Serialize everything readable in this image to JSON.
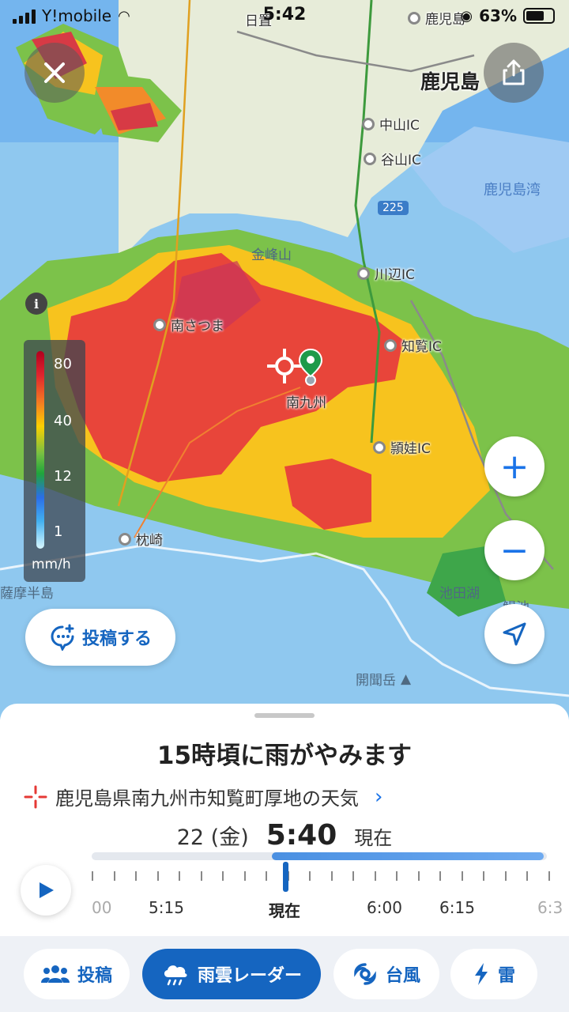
{
  "status_bar": {
    "carrier": "Y!mobile",
    "time": "5:42",
    "battery": "63%"
  },
  "map": {
    "places": {
      "hioki": "日置",
      "kagoshima_top": "鹿児島",
      "kagoshima_city": "鹿児島",
      "nakayama_ic": "中山IC",
      "taniyama_ic": "谷山IC",
      "kagoshima_bay": "鹿児島湾",
      "route_225": "225",
      "kinposan": "金峰山",
      "kawanabe_ic": "川辺IC",
      "minamisatsuma": "南さつま",
      "chiran_ic": "知覧IC",
      "minamikyushu": "南九州",
      "eino_ic": "頴娃IC",
      "makurazaki": "枕崎",
      "satsuma_hanto": "薩摩半島",
      "ikeda_ko": "池田湖",
      "ike": "鰻池",
      "kaimondake": "開聞岳"
    },
    "legend": {
      "ticks": [
        "80",
        "40",
        "12",
        "1"
      ],
      "unit": "mm/h"
    },
    "post_button": "投稿する",
    "icons": {
      "close": "close-icon",
      "share": "share-icon",
      "zoom_in": "+",
      "zoom_out": "−",
      "locate": "navigation-arrow-icon",
      "pin": "location-pin-icon"
    }
  },
  "sheet": {
    "headline": "15時頃に雨がやみます",
    "location": "鹿児島県南九州市知覧町厚地の天気",
    "date": "22 (金)",
    "current_time": "5:40",
    "current_label": "現在",
    "timeline": {
      "labels": [
        "00",
        "5:15",
        "現在",
        "6:00",
        "6:15",
        "6:3"
      ],
      "progress_now": 0.43
    }
  },
  "nav": {
    "items": [
      {
        "label": "投稿",
        "icon": "people-icon"
      },
      {
        "label": "雨雲レーダー",
        "icon": "rain-cloud-icon",
        "active": true
      },
      {
        "label": "台風",
        "icon": "typhoon-icon"
      },
      {
        "label": "雷",
        "icon": "lightning-icon"
      }
    ]
  },
  "colors": {
    "accent": "#1565c0",
    "heavy_rain": "#e0242e",
    "moderate_rain": "#f47b22",
    "light_rain": "#76c043",
    "drizzle": "#41b0f0"
  }
}
